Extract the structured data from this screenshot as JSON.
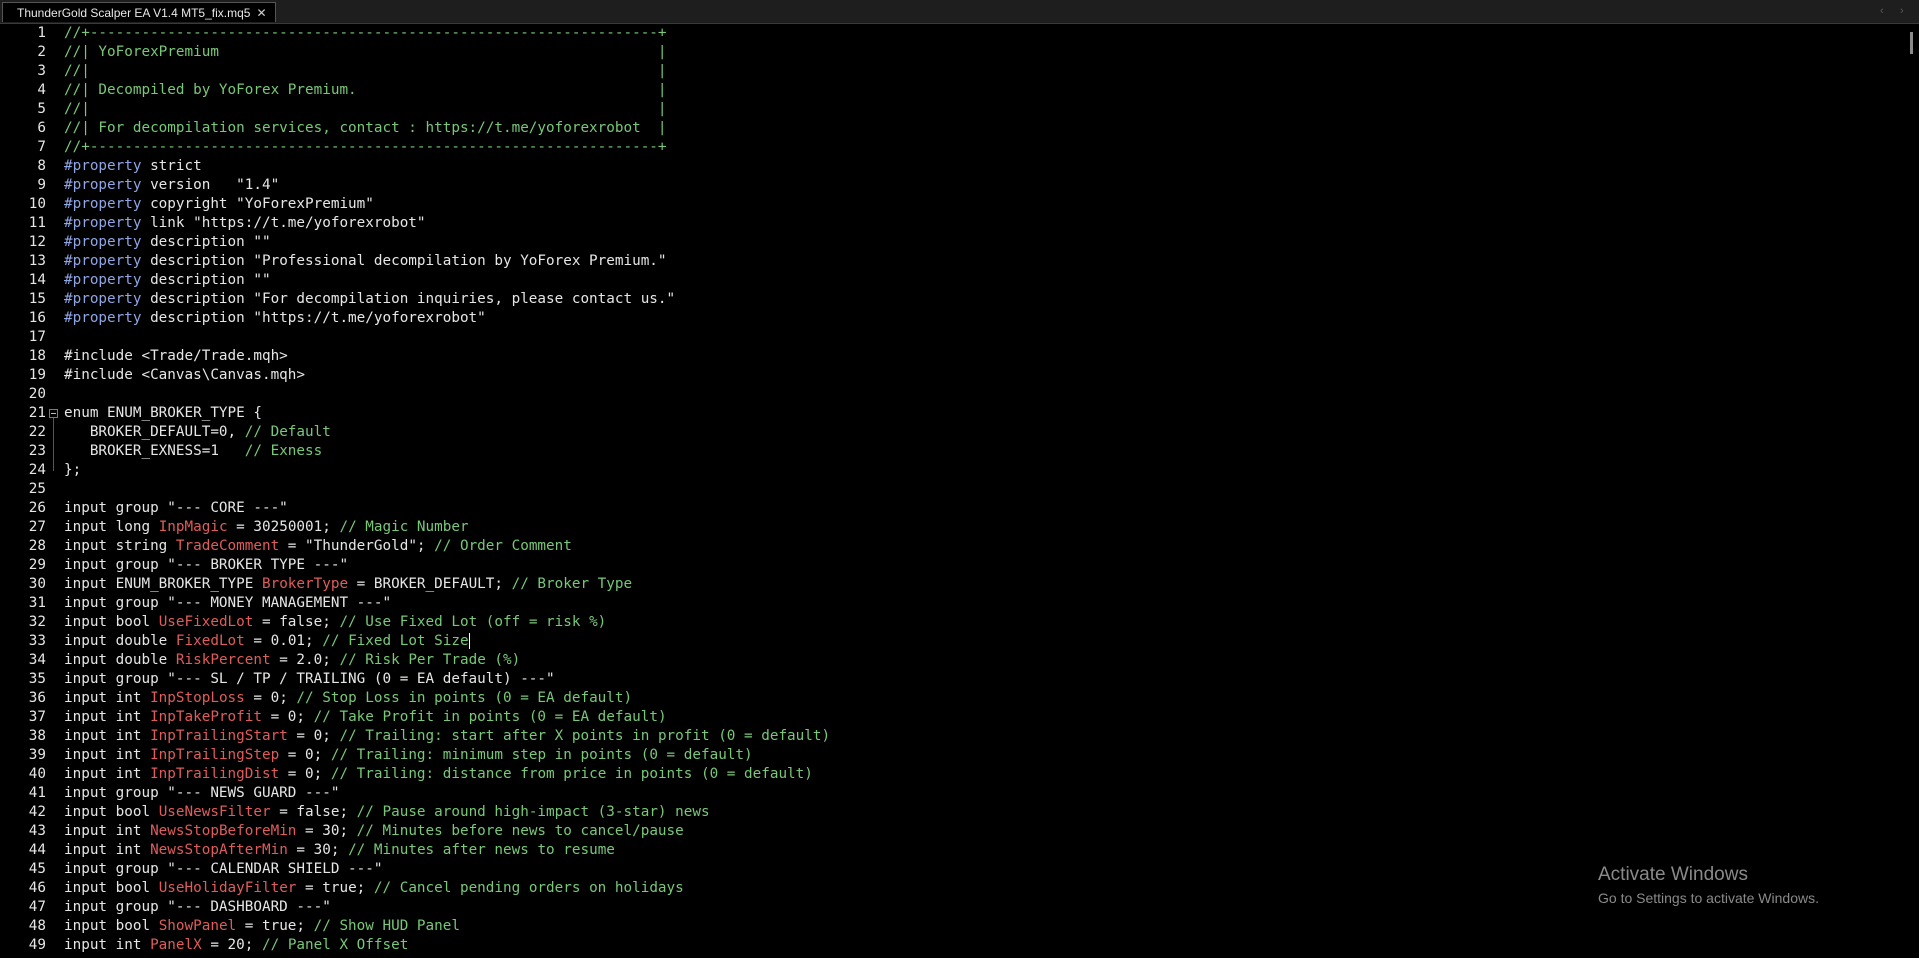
{
  "tab": {
    "title": "ThunderGold Scalper EA V1.4 MT5_fix.mq5",
    "close_glyph": "✕"
  },
  "nav": {
    "prev": "‹",
    "next": "›"
  },
  "watermark": {
    "title": "Activate Windows",
    "subtitle": "Go to Settings to activate Windows."
  },
  "editor": {
    "lines": [
      {
        "n": "1",
        "t": [
          [
            "//+------------------------------------------------------------------+",
            "com"
          ]
        ]
      },
      {
        "n": "2",
        "t": [
          [
            "//| YoForexPremium                                                   |",
            "com"
          ]
        ]
      },
      {
        "n": "3",
        "t": [
          [
            "//|                                                                  |",
            "com"
          ]
        ]
      },
      {
        "n": "4",
        "t": [
          [
            "//| Decompiled by YoForex Premium.                                   |",
            "com"
          ]
        ]
      },
      {
        "n": "5",
        "t": [
          [
            "//|                                                                  |",
            "com"
          ]
        ]
      },
      {
        "n": "6",
        "t": [
          [
            "//| For decompilation services, contact : https://t.me/yoforexrobot  |",
            "com"
          ]
        ]
      },
      {
        "n": "7",
        "t": [
          [
            "//+------------------------------------------------------------------+",
            "com"
          ]
        ]
      },
      {
        "n": "8",
        "t": [
          [
            "#property",
            "pp"
          ],
          [
            " strict",
            "plain"
          ]
        ]
      },
      {
        "n": "9",
        "t": [
          [
            "#property",
            "pp"
          ],
          [
            " version   \"1.4\"",
            "plain"
          ]
        ]
      },
      {
        "n": "10",
        "t": [
          [
            "#property",
            "pp"
          ],
          [
            " copyright \"YoForexPremium\"",
            "plain"
          ]
        ]
      },
      {
        "n": "11",
        "t": [
          [
            "#property",
            "pp"
          ],
          [
            " link \"https://t.me/yoforexrobot\"",
            "plain"
          ]
        ]
      },
      {
        "n": "12",
        "t": [
          [
            "#property",
            "pp"
          ],
          [
            " description \"\"",
            "plain"
          ]
        ]
      },
      {
        "n": "13",
        "t": [
          [
            "#property",
            "pp"
          ],
          [
            " description \"Professional decompilation by YoForex Premium.\"",
            "plain"
          ]
        ]
      },
      {
        "n": "14",
        "t": [
          [
            "#property",
            "pp"
          ],
          [
            " description \"\"",
            "plain"
          ]
        ]
      },
      {
        "n": "15",
        "t": [
          [
            "#property",
            "pp"
          ],
          [
            " description \"For decompilation inquiries, please contact us.\"",
            "plain"
          ]
        ]
      },
      {
        "n": "16",
        "t": [
          [
            "#property",
            "pp"
          ],
          [
            " description \"https://t.me/yoforexrobot\"",
            "plain"
          ]
        ]
      },
      {
        "n": "17",
        "t": []
      },
      {
        "n": "18",
        "t": [
          [
            "#include <Trade/Trade.mqh>",
            "plain"
          ]
        ]
      },
      {
        "n": "19",
        "t": [
          [
            "#include <Canvas\\Canvas.mqh>",
            "plain"
          ]
        ]
      },
      {
        "n": "20",
        "t": []
      },
      {
        "n": "21",
        "t": [
          [
            "enum ENUM_BROKER_TYPE {",
            "plain"
          ]
        ]
      },
      {
        "n": "22",
        "t": [
          [
            "   BROKER_DEFAULT=0, ",
            "plain"
          ],
          [
            "// Default",
            "com"
          ]
        ]
      },
      {
        "n": "23",
        "t": [
          [
            "   BROKER_EXNESS=1   ",
            "plain"
          ],
          [
            "// Exness",
            "com"
          ]
        ]
      },
      {
        "n": "24",
        "t": [
          [
            "};",
            "plain"
          ]
        ]
      },
      {
        "n": "25",
        "t": []
      },
      {
        "n": "26",
        "t": [
          [
            "input group \"--- CORE ---\"",
            "plain"
          ]
        ]
      },
      {
        "n": "27",
        "t": [
          [
            "input long ",
            "plain"
          ],
          [
            "InpMagic",
            "var"
          ],
          [
            " = 30250001; ",
            "plain"
          ],
          [
            "// Magic Number",
            "com"
          ]
        ]
      },
      {
        "n": "28",
        "t": [
          [
            "input string ",
            "plain"
          ],
          [
            "TradeComment",
            "var"
          ],
          [
            " = \"ThunderGold\"; ",
            "plain"
          ],
          [
            "// Order Comment",
            "com"
          ]
        ]
      },
      {
        "n": "29",
        "t": [
          [
            "input group \"--- BROKER TYPE ---\"",
            "plain"
          ]
        ]
      },
      {
        "n": "30",
        "t": [
          [
            "input ENUM_BROKER_TYPE ",
            "plain"
          ],
          [
            "BrokerType",
            "var"
          ],
          [
            " = BROKER_DEFAULT; ",
            "plain"
          ],
          [
            "// Broker Type",
            "com"
          ]
        ]
      },
      {
        "n": "31",
        "t": [
          [
            "input group \"--- MONEY MANAGEMENT ---\"",
            "plain"
          ]
        ]
      },
      {
        "n": "32",
        "t": [
          [
            "input bool ",
            "plain"
          ],
          [
            "UseFixedLot",
            "var"
          ],
          [
            " = false; ",
            "plain"
          ],
          [
            "// Use Fixed Lot (off = risk %)",
            "com"
          ]
        ]
      },
      {
        "n": "33",
        "t": [
          [
            "input double ",
            "plain"
          ],
          [
            "FixedLot",
            "var"
          ],
          [
            " = 0.01; ",
            "plain"
          ],
          [
            "// Fixed Lot Size",
            "com"
          ]
        ],
        "caret": true
      },
      {
        "n": "34",
        "t": [
          [
            "input double ",
            "plain"
          ],
          [
            "RiskPercent",
            "var"
          ],
          [
            " = 2.0; ",
            "plain"
          ],
          [
            "// Risk Per Trade (%)",
            "com"
          ]
        ]
      },
      {
        "n": "35",
        "t": [
          [
            "input group \"--- SL / TP / TRAILING (0 = EA default) ---\"",
            "plain"
          ]
        ]
      },
      {
        "n": "36",
        "t": [
          [
            "input int ",
            "plain"
          ],
          [
            "InpStopLoss",
            "var"
          ],
          [
            " = 0; ",
            "plain"
          ],
          [
            "// Stop Loss in points (0 = EA default)",
            "com"
          ]
        ]
      },
      {
        "n": "37",
        "t": [
          [
            "input int ",
            "plain"
          ],
          [
            "InpTakeProfit",
            "var"
          ],
          [
            " = 0; ",
            "plain"
          ],
          [
            "// Take Profit in points (0 = EA default)",
            "com"
          ]
        ]
      },
      {
        "n": "38",
        "t": [
          [
            "input int ",
            "plain"
          ],
          [
            "InpTrailingStart",
            "var"
          ],
          [
            " = 0; ",
            "plain"
          ],
          [
            "// Trailing: start after X points in profit (0 = default)",
            "com"
          ]
        ]
      },
      {
        "n": "39",
        "t": [
          [
            "input int ",
            "plain"
          ],
          [
            "InpTrailingStep",
            "var"
          ],
          [
            " = 0; ",
            "plain"
          ],
          [
            "// Trailing: minimum step in points (0 = default)",
            "com"
          ]
        ]
      },
      {
        "n": "40",
        "t": [
          [
            "input int ",
            "plain"
          ],
          [
            "InpTrailingDist",
            "var"
          ],
          [
            " = 0; ",
            "plain"
          ],
          [
            "// Trailing: distance from price in points (0 = default)",
            "com"
          ]
        ]
      },
      {
        "n": "41",
        "t": [
          [
            "input group \"--- NEWS GUARD ---\"",
            "plain"
          ]
        ]
      },
      {
        "n": "42",
        "t": [
          [
            "input bool ",
            "plain"
          ],
          [
            "UseNewsFilter",
            "var"
          ],
          [
            " = false; ",
            "plain"
          ],
          [
            "// Pause around high-impact (3-star) news",
            "com"
          ]
        ]
      },
      {
        "n": "43",
        "t": [
          [
            "input int ",
            "plain"
          ],
          [
            "NewsStopBeforeMin",
            "var"
          ],
          [
            " = 30; ",
            "plain"
          ],
          [
            "// Minutes before news to cancel/pause",
            "com"
          ]
        ]
      },
      {
        "n": "44",
        "t": [
          [
            "input int ",
            "plain"
          ],
          [
            "NewsStopAfterMin",
            "var"
          ],
          [
            " = 30; ",
            "plain"
          ],
          [
            "// Minutes after news to resume",
            "com"
          ]
        ]
      },
      {
        "n": "45",
        "t": [
          [
            "input group \"--- CALENDAR SHIELD ---\"",
            "plain"
          ]
        ]
      },
      {
        "n": "46",
        "t": [
          [
            "input bool ",
            "plain"
          ],
          [
            "UseHolidayFilter",
            "var"
          ],
          [
            " = true; ",
            "plain"
          ],
          [
            "// Cancel pending orders on holidays",
            "com"
          ]
        ]
      },
      {
        "n": "47",
        "t": [
          [
            "input group \"--- DASHBOARD ---\"",
            "plain"
          ]
        ]
      },
      {
        "n": "48",
        "t": [
          [
            "input bool ",
            "plain"
          ],
          [
            "ShowPanel",
            "var"
          ],
          [
            " = true; ",
            "plain"
          ],
          [
            "// Show HUD Panel",
            "com"
          ]
        ]
      },
      {
        "n": "49",
        "t": [
          [
            "input int ",
            "plain"
          ],
          [
            "PanelX",
            "var"
          ],
          [
            " = 20; ",
            "plain"
          ],
          [
            "// Panel X Offset",
            "com"
          ]
        ]
      }
    ]
  }
}
